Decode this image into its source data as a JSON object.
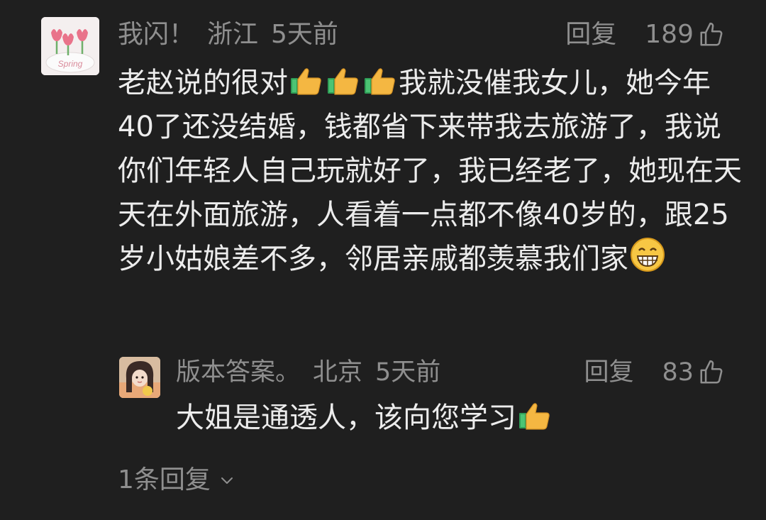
{
  "main_comment": {
    "username": "我闪！",
    "location": "浙江",
    "time": "5天前",
    "reply_label": "回复",
    "like_count": "189",
    "text_before": "老赵说的很对",
    "text_middle": "我就没催我女儿，她今年40了还没结婚，钱都省下来带我去旅游了，我说你们年轻人自己玩就好了，我已经老了，她现在天天在外面旅游，人看着一点都不像40岁的，跟25岁小姑娘差不多，邻居亲戚都羡慕我们家",
    "avatar_label": "Spring"
  },
  "reply_comment": {
    "username": "版本答案。",
    "location": "北京",
    "time": "5天前",
    "reply_label": "回复",
    "like_count": "83",
    "text": "大姐是通透人，该向您学习"
  },
  "more_replies_label": "1条回复",
  "icons": {
    "like": "thumbs-up-outline-icon",
    "expand": "chevron-down-icon",
    "emoji_thumb": "thumbs-up-emoji",
    "emoji_grin": "grinning-face-emoji"
  },
  "colors": {
    "background": "#1f1f1f",
    "meta_text": "#8f8f8f",
    "body_text": "#ececec"
  }
}
